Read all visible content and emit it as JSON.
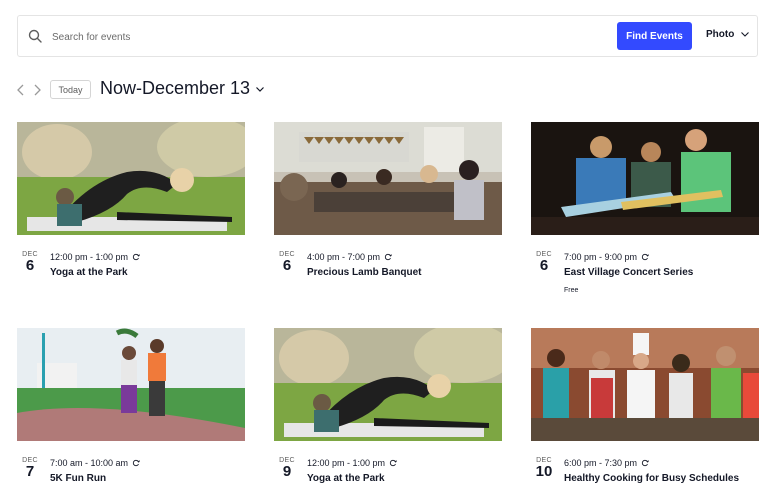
{
  "search": {
    "placeholder": "Search for events",
    "button_label": "Find Events",
    "view_label": "Photo"
  },
  "nav": {
    "today_label": "Today",
    "date_range": "Now-December 13"
  },
  "events": [
    {
      "month": "DEC",
      "day": "6",
      "time": "12:00 pm - 1:00 pm",
      "title": "Yoga at the Park",
      "cost": ""
    },
    {
      "month": "DEC",
      "day": "6",
      "time": "4:00 pm - 7:00 pm",
      "title": "Precious Lamb Banquet",
      "cost": ""
    },
    {
      "month": "DEC",
      "day": "6",
      "time": "7:00 pm - 9:00 pm",
      "title": "East Village Concert Series",
      "cost": "Free"
    },
    {
      "month": "DEC",
      "day": "7",
      "time": "7:00 am - 10:00 am",
      "title": "5K Fun Run",
      "cost": ""
    },
    {
      "month": "DEC",
      "day": "9",
      "time": "12:00 pm - 1:00 pm",
      "title": "Yoga at the Park",
      "cost": ""
    },
    {
      "month": "DEC",
      "day": "10",
      "time": "6:00 pm - 7:30 pm",
      "title": "Healthy Cooking for Busy Schedules",
      "cost": ""
    }
  ],
  "icons": {
    "search": "search-icon",
    "recurring": "recurring-icon",
    "prev": "chevron-left-icon",
    "next": "chevron-right-icon",
    "dropdown": "chevron-down-icon"
  },
  "colors": {
    "accent": "#334aff",
    "text": "#141827",
    "muted": "#5d5d5d"
  }
}
